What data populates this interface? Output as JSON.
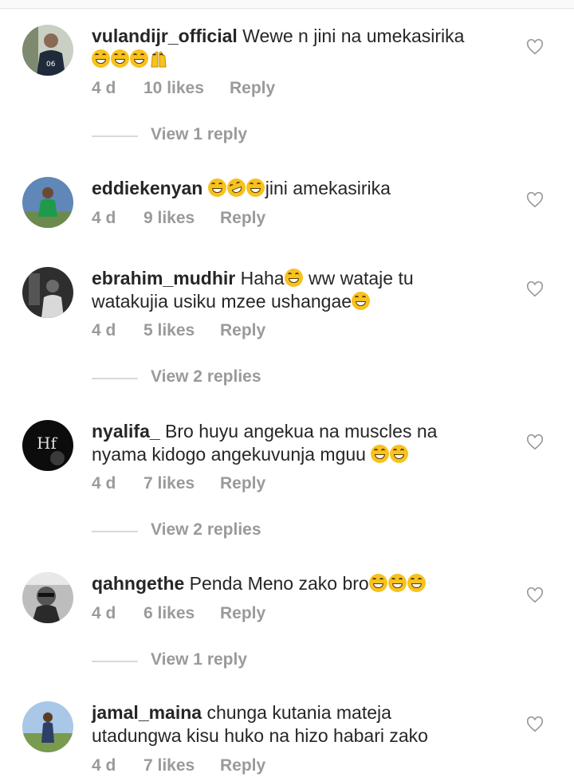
{
  "comments": [
    {
      "username": "vulandijr_official",
      "text": "Wewe n jini na umekasirika",
      "line2_emojis": [
        "grin",
        "grin",
        "grin",
        "raised-hands"
      ],
      "age": "4 d",
      "likes": "10 likes",
      "reply": "Reply",
      "view_replies": "View 1 reply"
    },
    {
      "username": "eddiekenyan",
      "pre_emojis": [
        "grin",
        "rofl",
        "grin"
      ],
      "text": "jini amekasirika",
      "age": "4 d",
      "likes": "9 likes",
      "reply": "Reply"
    },
    {
      "username": "ebrahim_mudhir",
      "text": "Haha",
      "text2": " ww wataje tu",
      "line2": "watakujia usiku mzee ushangae",
      "age": "4 d",
      "likes": "5 likes",
      "reply": "Reply",
      "view_replies": "View 2 replies"
    },
    {
      "username": "nyalifa_",
      "text": "Bro huyu angekua na muscles na",
      "line2": "nyama kidogo angekuvunja mguu",
      "age": "4 d",
      "likes": "7 likes",
      "reply": "Reply",
      "view_replies": "View 2 replies"
    },
    {
      "username": "qahngethe",
      "text": "Penda Meno zako bro",
      "age": "4 d",
      "likes": "6 likes",
      "reply": "Reply",
      "view_replies": "View 1 reply"
    },
    {
      "username": "jamal_maina",
      "text": "chunga kutania mateja",
      "line2": "utadungwa kisu huko na hizo habari zako",
      "age": "4 d",
      "likes": "7 likes",
      "reply": "Reply"
    }
  ],
  "colors": {
    "username": "#262626",
    "meta": "#9a9a9a",
    "emoji": "#f7c21e"
  },
  "icons": {
    "like": "heart-outline-icon"
  }
}
